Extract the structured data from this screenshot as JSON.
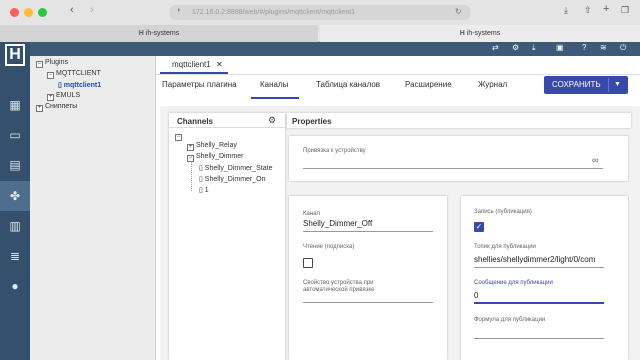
{
  "browser": {
    "url": "172.16.0.2:8888/web/#/plugins/mqttclient/mqttclient1",
    "tabs": [
      {
        "title": "ih-systems"
      },
      {
        "title": "ih-systems"
      }
    ]
  },
  "tree": {
    "plugins": "Plugins",
    "mqttclient": "MQTTCLIENT",
    "mqttclient1": "mqttclient1",
    "emuls": "EMULS",
    "snippets": "Сниппеты"
  },
  "main": {
    "instance_tab": "mqttclient1",
    "nav": [
      "Параметры плагина",
      "Каналы",
      "Таблица каналов",
      "Расширение",
      "Журнал"
    ],
    "save_label": "СОХРАНИТЬ"
  },
  "channels": {
    "header": "Channels",
    "relay": "Shelly_Relay",
    "dimmer": "Shelly_Dimmer",
    "dimmer_state": "Shelly_Dimmer_State",
    "dimmer_on": "Shelly_Dimmer_On",
    "one": "1"
  },
  "properties": {
    "header": "Properties",
    "binding_label": "Привязка к устройству",
    "channel_label": "Канал",
    "channel_value": "Shelly_Dimmer_Off",
    "read_label": "Чтение (подписка)",
    "device_prop_label": "Свойство устройства при",
    "device_prop_label2": "автоматической привязке",
    "write_label": "Запись (публикация)",
    "topic_label": "Топик для публикации",
    "topic_value": "shellies/shellydimmer2/light/0/com",
    "message_label": "Сообщение для публикации",
    "message_value": "0",
    "formula_label": "Формула для публикации"
  }
}
